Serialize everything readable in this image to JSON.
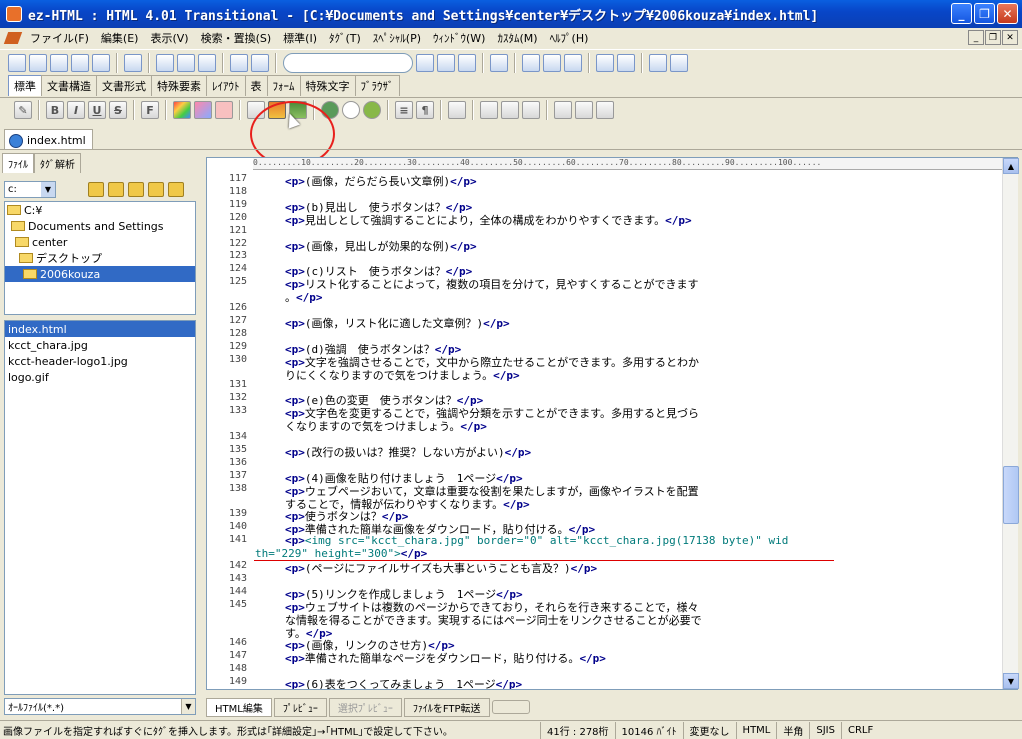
{
  "window": {
    "title": "ez-HTML : HTML 4.01 Transitional - [C:¥Documents and Settings¥center¥デスクトップ¥2006kouza¥index.html]"
  },
  "menu": [
    "ファイル(F)",
    "編集(E)",
    "表示(V)",
    "検索・置換(S)",
    "標準(I)",
    "ﾀｸﾞ(T)",
    "ｽﾍﾟｼｬﾙ(P)",
    "ｳｨﾝﾄﾞｳ(W)",
    "ｶｽﾀﾑ(M)",
    "ﾍﾙﾌﾟ(H)"
  ],
  "toolbar_tabs": [
    "標準",
    "文書構造",
    "文書形式",
    "特殊要素",
    "ﾚｲｱｳﾄ",
    "表",
    "ﾌｫｰﾑ",
    "特殊文字",
    "ﾌﾞﾗｳｻﾞ"
  ],
  "toolbar2": [
    "B",
    "I",
    "U",
    "S",
    "F"
  ],
  "document_tab": "index.html",
  "left_tabs": [
    "ﾌｧｲﾙ",
    "ﾀｸﾞ解析"
  ],
  "drive": "c:",
  "tree": [
    {
      "label": "C:¥",
      "indent": 0
    },
    {
      "label": "Documents and Settings",
      "indent": 1
    },
    {
      "label": "center",
      "indent": 2
    },
    {
      "label": "デスクトップ",
      "indent": 3
    },
    {
      "label": "2006kouza",
      "indent": 4,
      "selected": true
    }
  ],
  "files": [
    {
      "name": "index.html",
      "selected": true
    },
    {
      "name": "kcct_chara.jpg"
    },
    {
      "name": "kcct-header-logo1.jpg"
    },
    {
      "name": "logo.gif"
    }
  ],
  "filter": "ｵｰﾙﾌｧｲﾙ(*.*)",
  "ruler_text": "0.........10.........20.........30.........40.........50.........60.........70.........80.........90.........100......",
  "lines": [
    {
      "n": "117",
      "code": "<p>(画像，だらだら長い文章例)</p>"
    },
    {
      "n": "118",
      "code": ""
    },
    {
      "n": "119",
      "code": "<p>(b)見出し　使うボタンは？</p>"
    },
    {
      "n": "120",
      "code": "<p>見出しとして強調することにより，全体の構成をわかりやすくできます。</p>"
    },
    {
      "n": "121",
      "code": ""
    },
    {
      "n": "122",
      "code": "<p>(画像，見出しが効果的な例)</p>"
    },
    {
      "n": "123",
      "code": ""
    },
    {
      "n": "124",
      "code": "<p>(c)リスト　使うボタンは？</p>"
    },
    {
      "n": "125",
      "code": "<p>リスト化することによって，複数の項目を分けて，見やすくすることができます"
    },
    {
      "n": "",
      "code": "。</p>"
    },
    {
      "n": "126",
      "code": ""
    },
    {
      "n": "127",
      "code": "<p>(画像，リスト化に適した文章例？)</p>"
    },
    {
      "n": "128",
      "code": ""
    },
    {
      "n": "129",
      "code": "<p>(d)強調　使うボタンは？</p>"
    },
    {
      "n": "130",
      "code": "<p>文字を強調させることで，文中から際立たせることができます。多用するとわか"
    },
    {
      "n": "",
      "code": "りにくくなりますので気をつけましょう。</p>"
    },
    {
      "n": "131",
      "code": ""
    },
    {
      "n": "132",
      "code": "<p>(e)色の変更　使うボタンは？</p>"
    },
    {
      "n": "133",
      "code": "<p>文字色を変更することで，強調や分類を示すことができます。多用すると見づら"
    },
    {
      "n": "",
      "code": "くなりますので気をつけましょう。</p>"
    },
    {
      "n": "134",
      "code": ""
    },
    {
      "n": "135",
      "code": "<p>(改行の扱いは？推奨？しない方がよい)</p>"
    },
    {
      "n": "136",
      "code": ""
    },
    {
      "n": "137",
      "code": "<p>(4)画像を貼り付けましょう　1ページ</p>"
    },
    {
      "n": "138",
      "code": "<p>ウェブページおいて，文章は重要な役割を果たしますが，画像やイラストを配置"
    },
    {
      "n": "",
      "code": "することで，情報が伝わりやすくなります。</p>"
    },
    {
      "n": "139",
      "code": "<p>使うボタンは？</p>"
    },
    {
      "n": "140",
      "code": "<p>準備された簡単な画像をダウンロード，貼り付ける。</p>"
    },
    {
      "n": "141",
      "code": "<p><img src=\"kcct_chara.jpg\" border=\"0\" alt=\"kcct_chara.jpg(17138 byte)\" wid"
    },
    {
      "n": "",
      "code": "th=\"229\" height=\"300\"></p>",
      "wrap_full": true
    },
    {
      "n": "142",
      "code": "<p>(ページにファイルサイズも大事ということも言及？)</p>"
    },
    {
      "n": "143",
      "code": ""
    },
    {
      "n": "144",
      "code": "<p>(5)リンクを作成しましょう　1ページ</p>"
    },
    {
      "n": "145",
      "code": "<p>ウェブサイトは複数のページからできており，それらを行き来することで，様々"
    },
    {
      "n": "",
      "code": "な情報を得ることができます。実現するにはページ同士をリンクさせることが必要で"
    },
    {
      "n": "",
      "code": "す。</p>"
    },
    {
      "n": "146",
      "code": "<p>(画像，リンクのさせ方)</p>"
    },
    {
      "n": "147",
      "code": "<p>準備された簡単なページをダウンロード，貼り付ける。</p>"
    },
    {
      "n": "148",
      "code": ""
    },
    {
      "n": "149",
      "code": "<p>(6)表をつくってみましょう　1ページ</p>"
    }
  ],
  "bottom_tabs": [
    "HTML編集",
    "ﾌﾟﾚﾋﾞｭｰ",
    "選択ﾌﾟﾚﾋﾞｭｰ",
    "ﾌｧｲﾙをFTP転送"
  ],
  "status": {
    "message": "画像ファイルを指定すればすぐにﾀｸﾞを挿入します。形式は｢詳細設定｣→｢HTML｣で設定して下さい。",
    "position": "41行 : 278桁",
    "size": "10146 ﾊﾞｲﾄ",
    "modified": "変更なし",
    "mode": "HTML",
    "width": "半角",
    "encoding": "SJIS",
    "newline": "CRLF"
  }
}
